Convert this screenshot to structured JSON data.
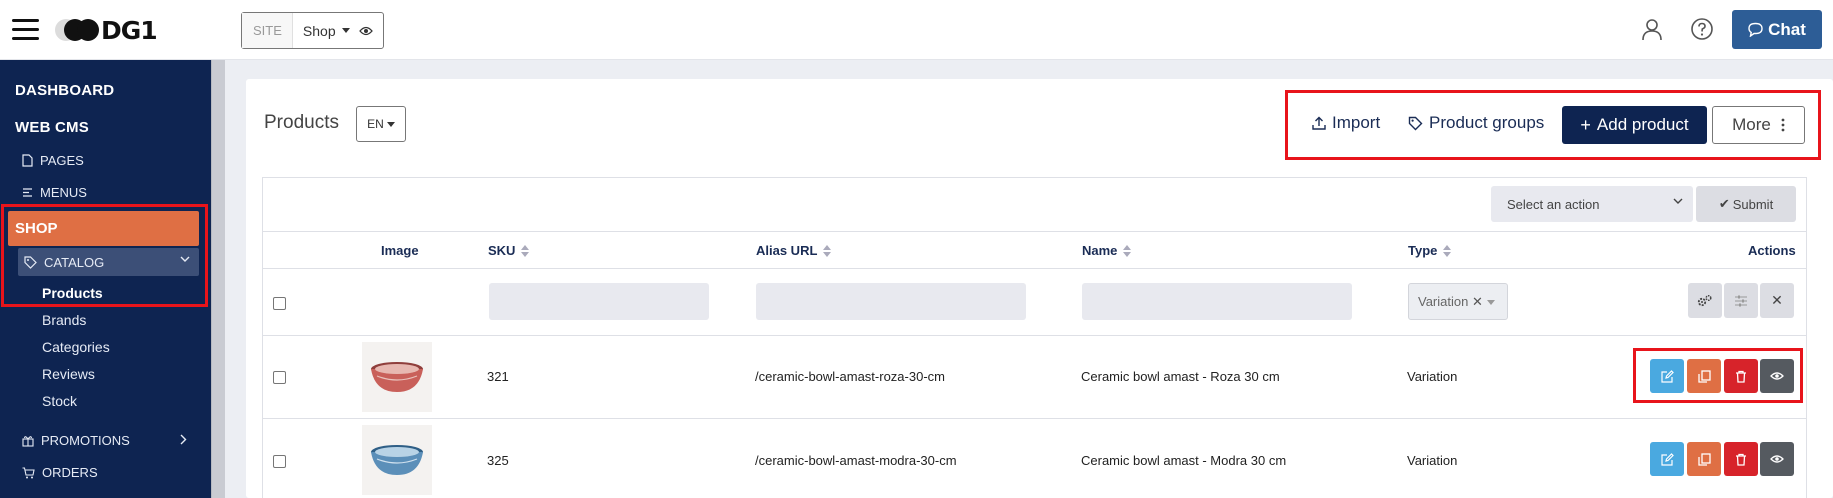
{
  "header": {
    "logo_text": "DG1",
    "site_label": "SITE",
    "site_value": "Shop",
    "chat_label": "Chat"
  },
  "sidebar": {
    "dashboard": "DASHBOARD",
    "web_cms": "WEB CMS",
    "pages": "PAGES",
    "menus": "MENUS",
    "shop": "SHOP",
    "catalog": "CATALOG",
    "catalog_items": [
      "Products",
      "Brands",
      "Categories",
      "Reviews",
      "Stock"
    ],
    "promotions": "PROMOTIONS",
    "orders": "ORDERS"
  },
  "page": {
    "title": "Products",
    "language": "EN",
    "import_label": "Import",
    "product_groups_label": "Product groups",
    "add_product_label": "Add product",
    "more_label": "More"
  },
  "bulk": {
    "select_placeholder": "Select an action",
    "submit_label": "Submit"
  },
  "table": {
    "columns": [
      "Image",
      "SKU",
      "Alias URL",
      "Name",
      "Type",
      "Actions"
    ],
    "type_filter_value": "Variation",
    "rows": [
      {
        "sku": "321",
        "alias": "/ceramic-bowl-amast-roza-30-cm",
        "name": "Ceramic bowl amast - Roza 30 cm",
        "type": "Variation",
        "bowl_color": "#c9605a"
      },
      {
        "sku": "325",
        "alias": "/ceramic-bowl-amast-modra-30-cm",
        "name": "Ceramic bowl amast - Modra 30 cm",
        "type": "Variation",
        "bowl_color": "#5b8fb9"
      }
    ]
  },
  "colors": {
    "navy": "#0e2451",
    "orange": "#df6f44",
    "blue_btn": "#2d5d96",
    "highlight": "#e8141b"
  }
}
